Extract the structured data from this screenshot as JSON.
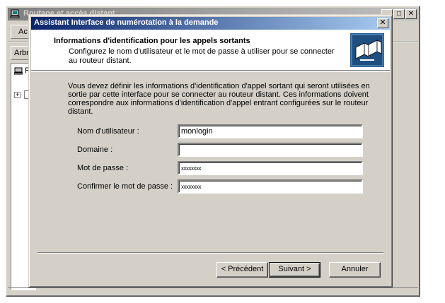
{
  "background_window": {
    "title": "Routage et accès distant",
    "toolbar_button": "Ac",
    "tab_label": "Arbr",
    "tree_root_label": "R",
    "expander": "+",
    "controls": {
      "minimize": "_",
      "maximize": "□",
      "close": "✕"
    }
  },
  "dialog": {
    "title": "Assistant Interface de numérotation à la demande",
    "close_label": "✕",
    "header": {
      "title": "Informations d'identification pour les appels sortants",
      "subtitle": "Configurez le nom d'utilisateur et le mot de passe à utiliser pour se connecter au routeur distant.",
      "icon": "network-connection-icon"
    },
    "intro": "Vous devez définir les informations d'identification d'appel sortant qui seront utilisées en sortie par cette interface pour se connecter au routeur distant. Ces informations doivent correspondre aux informations d'identification d'appel entrant configurées sur le routeur distant.",
    "fields": {
      "username": {
        "label": "Nom d'utilisateur :",
        "value": "monlogin"
      },
      "domain": {
        "label": "Domaine :",
        "value": ""
      },
      "password": {
        "label": "Mot de passe :",
        "value": "xxxxxxxx"
      },
      "confirm_password": {
        "label": "Confirmer le mot de passe :",
        "value": "xxxxxxxx"
      }
    },
    "buttons": {
      "back": "< Précédent",
      "next": "Suivant >",
      "cancel": "Annuler"
    }
  },
  "colors": {
    "face": "#d4d0c8",
    "title_active_start": "#0a246a",
    "title_active_end": "#a6caf0",
    "title_inactive": "#808080"
  }
}
